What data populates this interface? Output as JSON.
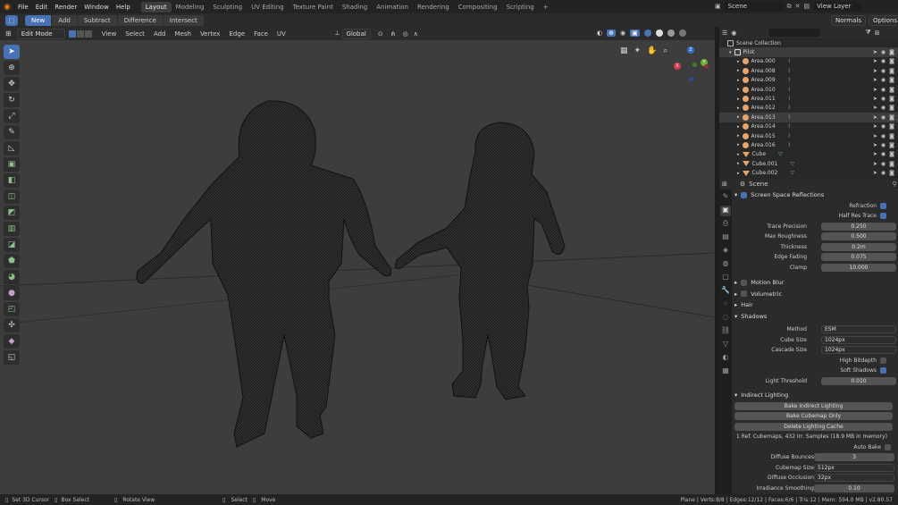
{
  "topbar": {
    "menus": [
      "File",
      "Edit",
      "Render",
      "Window",
      "Help"
    ],
    "workspaces": [
      "Layout",
      "Modeling",
      "Sculpting",
      "UV Editing",
      "Texture Paint",
      "Shading",
      "Animation",
      "Rendering",
      "Compositing",
      "Scripting"
    ],
    "active_workspace": "Layout",
    "add_tab": "+",
    "scene": "Scene",
    "view_layer": "View Layer"
  },
  "opbar": {
    "buttons": [
      "New",
      "Add",
      "Subtract",
      "Difference",
      "Intersect"
    ],
    "normals": "Normals",
    "options": "Options"
  },
  "vphead": {
    "mode": "Edit Mode",
    "menus": [
      "View",
      "Select",
      "Add",
      "Mesh",
      "Vertex",
      "Edge",
      "Face",
      "UV"
    ],
    "orientation": "Global"
  },
  "gizmo": {
    "x": "X",
    "y": "Y",
    "z": "Z"
  },
  "outliner": {
    "root": "Scene Collection",
    "items": [
      {
        "name": "Pilot",
        "type": "collection",
        "sel": true
      },
      {
        "name": "Area.000",
        "type": "light",
        "sel": false
      },
      {
        "name": "Area.008",
        "type": "light",
        "sel": false
      },
      {
        "name": "Area.009",
        "type": "light",
        "sel": false
      },
      {
        "name": "Area.010",
        "type": "light",
        "sel": false
      },
      {
        "name": "Area.011",
        "type": "light",
        "sel": false
      },
      {
        "name": "Area.012",
        "type": "light",
        "sel": false
      },
      {
        "name": "Area.013",
        "type": "light",
        "sel": true
      },
      {
        "name": "Area.014",
        "type": "light",
        "sel": false
      },
      {
        "name": "Area.015",
        "type": "light",
        "sel": false
      },
      {
        "name": "Area.016",
        "type": "light",
        "sel": false
      },
      {
        "name": "Cube",
        "type": "mesh",
        "sel": false
      },
      {
        "name": "Cube.001",
        "type": "mesh",
        "sel": false
      },
      {
        "name": "Cube.002",
        "type": "mesh",
        "sel": false
      }
    ]
  },
  "props": {
    "context": "Scene",
    "ssr_title": "Screen Space Reflections",
    "refraction": "Refraction",
    "half_res": "Half Res Trace",
    "fields": [
      {
        "label": "Trace Precision",
        "value": "0.250",
        "fill": 0.25
      },
      {
        "label": "Max Roughness",
        "value": "0.500",
        "fill": 0.5
      },
      {
        "label": "Thickness",
        "value": "0.2m",
        "fill": 0
      },
      {
        "label": "Edge Fading",
        "value": "0.075",
        "fill": 0.075
      },
      {
        "label": "Clamp",
        "value": "10.000",
        "fill": 0
      }
    ],
    "motion_blur": "Motion Blur",
    "volumetric": "Volumetric",
    "hair": "Hair",
    "shadows": "Shadows",
    "method_label": "Method",
    "method": "ESM",
    "cube_size_label": "Cube Size",
    "cube_size": "1024px",
    "cascade_label": "Cascade Size",
    "cascade": "1024px",
    "high_bitdepth": "High Bitdepth",
    "soft_shadows": "Soft Shadows",
    "light_threshold_label": "Light Threshold",
    "light_threshold": "0.010",
    "indirect": "Indirect Lighting",
    "bake_indirect": "Bake Indirect Lighting",
    "bake_cubemap": "Bake Cubemap Only",
    "delete_cache": "Delete Lighting Cache",
    "cache_info": "1 Ref. Cubemaps, 432 Irr. Samples (18.9 MB in memory)",
    "auto_bake": "Auto Bake",
    "diffuse_bounces_label": "Diffuse Bounces",
    "diffuse_bounces": "3",
    "cubemap_size_label": "Cubemap Size",
    "cubemap_size": "512px",
    "diffuse_occ_label": "Diffuse Occlusion",
    "diffuse_occ": "32px",
    "irr_smooth_label": "Irradiance Smoothing",
    "irr_smooth": "0.10"
  },
  "status": {
    "cursor": "Set 3D Cursor",
    "box": "Box Select",
    "rotate": "Rotate View",
    "select": "Select",
    "move": "Move",
    "stats": "Plane | Verts:8/8 | Edges:12/12 | Faces:6/6 | Tris:12 | Mem: 594.0 MB | v2.80.57"
  },
  "colors": {
    "accent": "#4772b3",
    "viewport": "#3d3d3d",
    "panel": "#2b2b2b"
  }
}
